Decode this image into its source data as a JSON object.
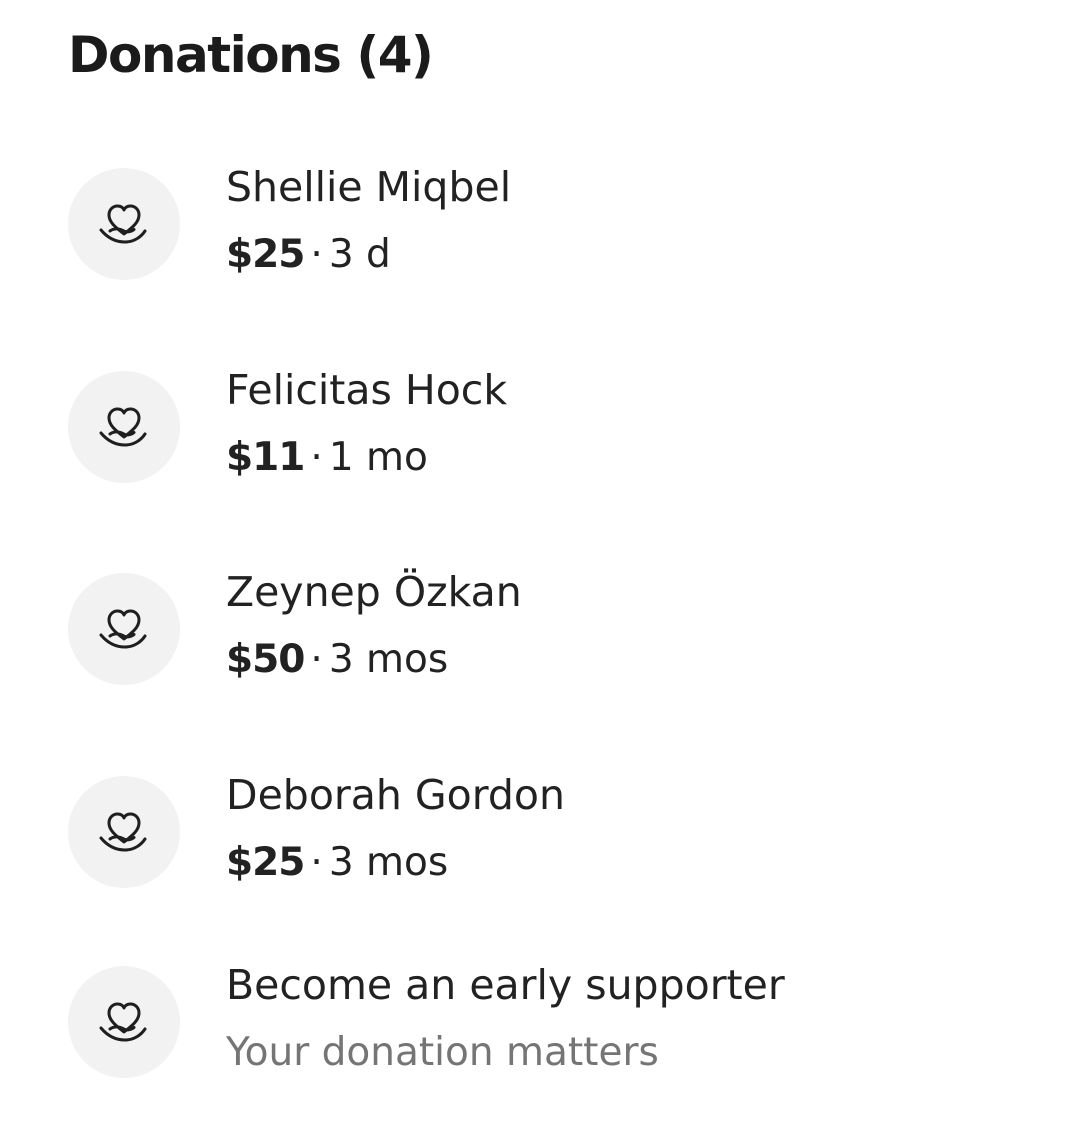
{
  "section": {
    "title": "Donations (4)"
  },
  "donations": [
    {
      "name": "Shellie Miqbel",
      "amount": "$25",
      "separator": "·",
      "time": "3 d"
    },
    {
      "name": "Felicitas Hock",
      "amount": "$11",
      "separator": "·",
      "time": "1 mo"
    },
    {
      "name": "Zeynep Özkan",
      "amount": "$50",
      "separator": "·",
      "time": "3 mos"
    },
    {
      "name": "Deborah Gordon",
      "amount": "$25",
      "separator": "·",
      "time": "3 mos"
    }
  ],
  "cta": {
    "title": "Become an early supporter",
    "subtitle": "Your donation matters"
  },
  "icons": {
    "donation": "heart-in-hand-icon"
  },
  "colors": {
    "text": "#222222",
    "muted": "#757575",
    "avatar_bg": "#f2f2f2"
  }
}
